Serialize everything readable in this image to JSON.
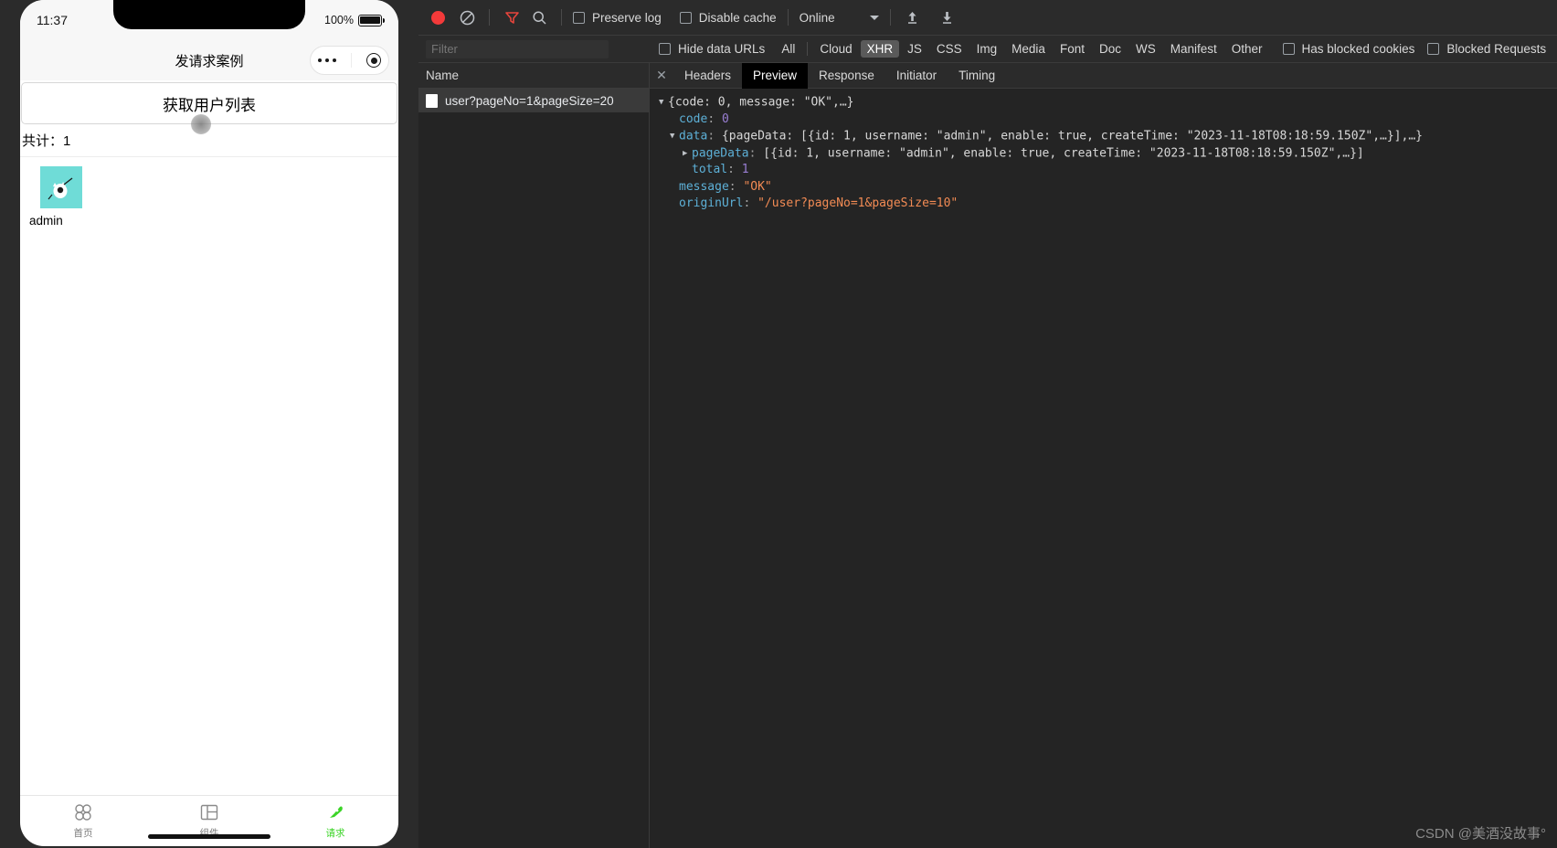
{
  "phone": {
    "status": {
      "time": "11:37",
      "battery_pct": "100%"
    },
    "nav": {
      "title": "发请求案例"
    },
    "action_button": {
      "label": "获取用户列表"
    },
    "total": {
      "label": "共计：1"
    },
    "users": [
      {
        "name": "admin"
      }
    ],
    "tabbar": [
      {
        "label": "首页",
        "icon": "grid-icon",
        "active": false
      },
      {
        "label": "组件",
        "icon": "layout-icon",
        "active": false
      },
      {
        "label": "请求",
        "icon": "plug-icon",
        "active": true
      }
    ]
  },
  "devtools": {
    "toolbar": {
      "record_icon": "record-icon",
      "clear_icon": "clear-icon",
      "filter_icon": "filter-icon",
      "search_icon": "search-icon",
      "preserve_log": "Preserve log",
      "disable_cache": "Disable cache",
      "throttle_value": "Online",
      "import_icon": "upload-arrow-icon",
      "export_icon": "download-arrow-icon"
    },
    "filterbar": {
      "filter_placeholder": "Filter",
      "filter_value": "",
      "hide_data_urls": "Hide data URLs",
      "types": [
        {
          "label": "All",
          "active": false
        },
        {
          "label": "Cloud",
          "active": false
        },
        {
          "label": "XHR",
          "active": true
        },
        {
          "label": "JS",
          "active": false
        },
        {
          "label": "CSS",
          "active": false
        },
        {
          "label": "Img",
          "active": false
        },
        {
          "label": "Media",
          "active": false
        },
        {
          "label": "Font",
          "active": false
        },
        {
          "label": "Doc",
          "active": false
        },
        {
          "label": "WS",
          "active": false
        },
        {
          "label": "Manifest",
          "active": false
        },
        {
          "label": "Other",
          "active": false
        }
      ],
      "has_blocked_cookies": "Has blocked cookies",
      "blocked_requests": "Blocked Requests"
    },
    "requests": {
      "column_header": "Name",
      "rows": [
        {
          "name": "user?pageNo=1&pageSize=20",
          "selected": true
        }
      ]
    },
    "detail_tabs": [
      {
        "label": "Headers",
        "active": false
      },
      {
        "label": "Preview",
        "active": true
      },
      {
        "label": "Response",
        "active": false
      },
      {
        "label": "Initiator",
        "active": false
      },
      {
        "label": "Timing",
        "active": false
      }
    ],
    "preview": {
      "l1": {
        "arrow": "▼",
        "text": "{code: 0, message: \"OK\",…}"
      },
      "l2": {
        "key": "code",
        "value": "0"
      },
      "l3": {
        "arrow": "▼",
        "key": "data",
        "text": "{pageData: [{id: 1, username: \"admin\", enable: true, createTime: \"2023-11-18T08:18:59.150Z\",…}],…}"
      },
      "l4": {
        "arrow": "▶",
        "key": "pageData",
        "text": "[{id: 1, username: \"admin\", enable: true, createTime: \"2023-11-18T08:18:59.150Z\",…}]"
      },
      "l5": {
        "key": "total",
        "value": "1"
      },
      "l6": {
        "key": "message",
        "value": "\"OK\""
      },
      "l7": {
        "key": "originUrl",
        "value": "\"/user?pageNo=1&pageSize=10\""
      }
    }
  },
  "watermark": {
    "text": "CSDN @美酒没故事°"
  },
  "colors": {
    "accent_green": "#3bd427",
    "record_red": "#f33a3a",
    "avatar_bg": "#6fdcd7",
    "devtools_bg": "#242424",
    "string_orange": "#f28b54",
    "key_blue": "#5db0d7",
    "number_purple": "#9a7fd4"
  }
}
